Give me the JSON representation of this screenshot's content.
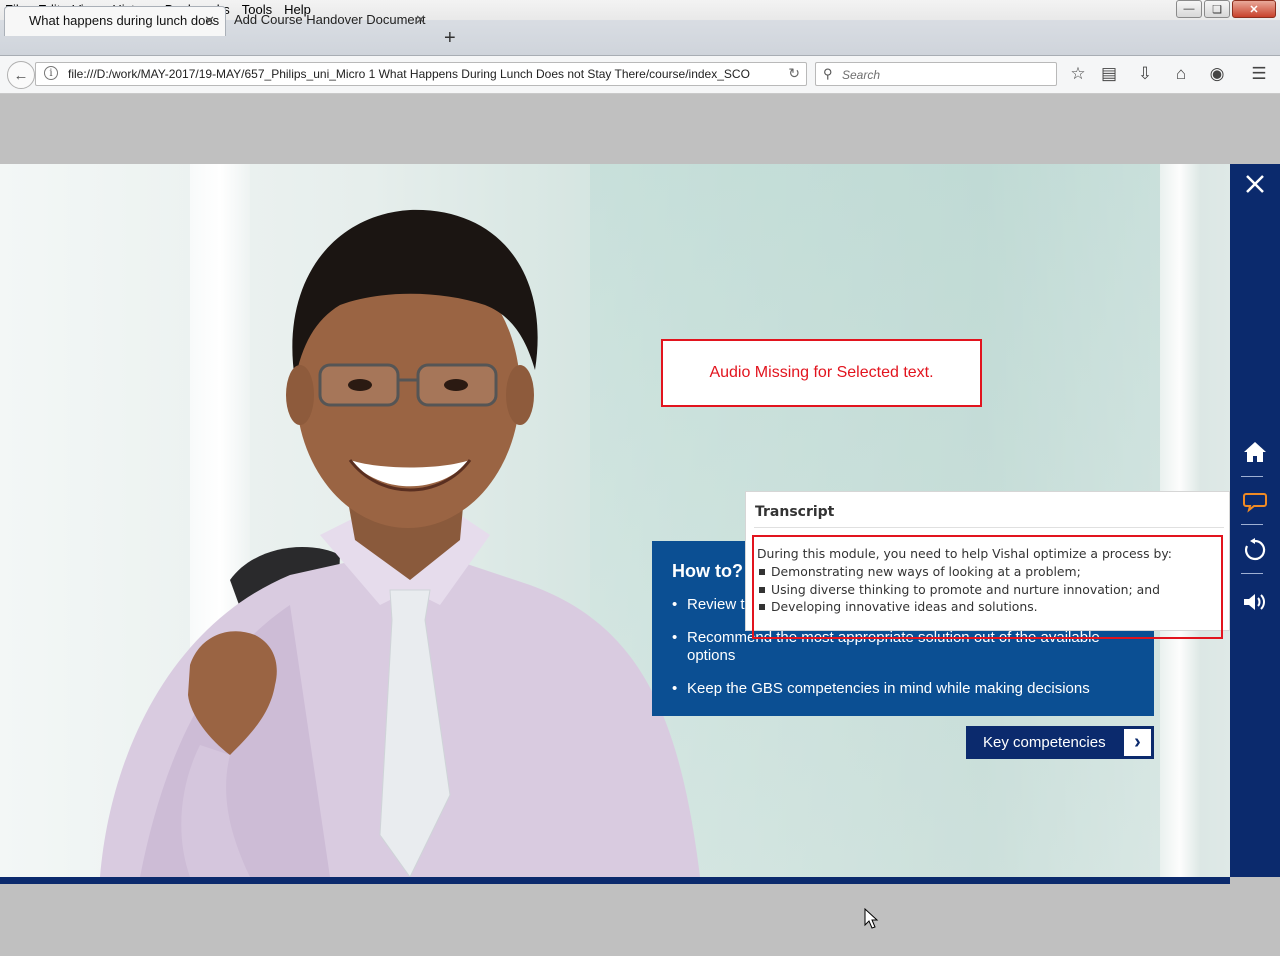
{
  "browser": {
    "menus": [
      "File",
      "Edit",
      "View",
      "History",
      "Bookmarks",
      "Tools",
      "Help"
    ],
    "tabs": [
      {
        "label": "What happens during lunch does",
        "active": true
      },
      {
        "label": "Add Course Handover Document",
        "active": false
      }
    ],
    "url": "file:///D:/work/MAY-2017/19-MAY/657_Philips_uni_Micro 1 What Happens During Lunch Does not Stay There/course/index_SCO",
    "search_placeholder": "Search"
  },
  "course": {
    "audio_note": "Audio Missing for Selected text.",
    "howto": {
      "title": "How to?",
      "items": [
        "Review t",
        "Recommend the most appropriate solution out of the available options",
        "Keep the GBS competencies in mind while making decisions"
      ]
    },
    "key_button": "Key competencies",
    "transcript": {
      "title": "Transcript",
      "intro": "During this module, you need to help Vishal optimize a process by:",
      "bullets": [
        "Demonstrating new ways of looking at a problem;",
        "Using diverse thinking to promote and nurture innovation; and",
        "Developing innovative ideas and solutions."
      ]
    },
    "sidebar_icons": [
      "close-icon",
      "home-icon",
      "transcript-icon",
      "replay-icon",
      "volume-icon"
    ],
    "colors": {
      "brand_navy": "#0b2a6d",
      "panel_blue": "#0b4f93",
      "alert_red": "#e2141e",
      "transcript_icon_orange": "#f08a24"
    }
  }
}
